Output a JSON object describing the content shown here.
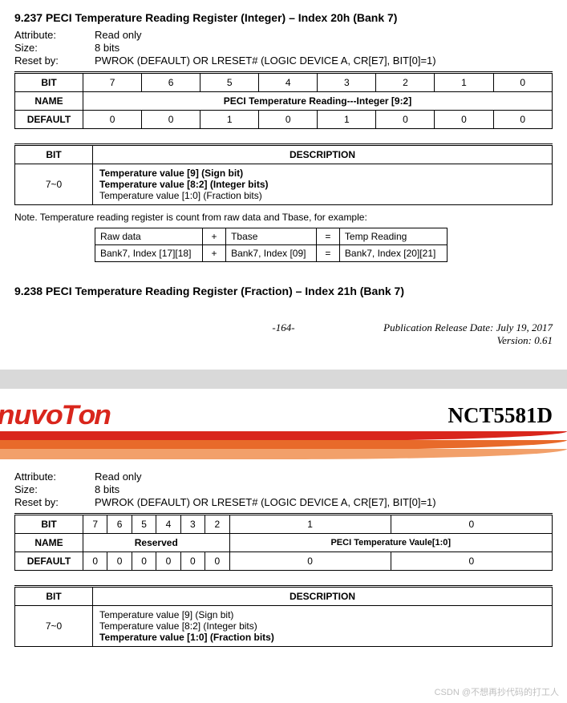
{
  "sec1": {
    "title": "9.237  PECI Temperature Reading Register (Integer) – Index 20h (Bank 7)",
    "attribute_l": "Attribute:",
    "attribute_v": "Read only",
    "size_l": "Size:",
    "size_v": "8 bits",
    "reset_l": "Reset by:",
    "reset_v": "PWROK (DEFAULT) OR LRESET# (LOGIC DEVICE A, CR[E7], BIT[0]=1)",
    "bit_hdr": "BIT",
    "bits": [
      "7",
      "6",
      "5",
      "4",
      "3",
      "2",
      "1",
      "0"
    ],
    "name_hdr": "NAME",
    "name_span": "PECI Temperature Reading---Integer  [9:2]",
    "default_hdr": "DEFAULT",
    "defaults": [
      "0",
      "0",
      "1",
      "0",
      "1",
      "0",
      "0",
      "0"
    ],
    "desc": {
      "hdr_bit": "BIT",
      "hdr_desc": "DESCRIPTION",
      "bit": "7~0",
      "l1": "Temperature value [9] (Sign bit)",
      "l2": "Temperature value [8:2] (Integer bits)",
      "l3": "Temperature value [1:0] (Fraction bits)"
    },
    "note": "Note. Temperature reading register is count from raw data and Tbase, for example:",
    "ex": {
      "r1c1": "Raw data",
      "plus": "+",
      "r1c2": "Tbase",
      "eq": "=",
      "r1c3": "Temp Reading",
      "r2c1": "Bank7, Index [17][18]",
      "r2c2": "Bank7, Index [09]",
      "r2c3": "Bank7, Index [20][21]"
    }
  },
  "sec2": {
    "title": "9.238  PECI Temperature Reading Register (Fraction) – Index 21h (Bank 7)"
  },
  "footer": {
    "page": "-164-",
    "l1": "Publication Release Date: July 19, 2017",
    "l2": "Version: 0.61"
  },
  "brand": {
    "logo": "nUVOTON",
    "part": "NCT5581D"
  },
  "sec3": {
    "attribute_l": "Attribute:",
    "attribute_v": "Read only",
    "size_l": "Size:",
    "size_v": "8 bits",
    "reset_l": "Reset by:",
    "reset_v": "PWROK (DEFAULT) OR LRESET# (LOGIC DEVICE A, CR[E7], BIT[0]=1)",
    "bit_hdr": "BIT",
    "bits": [
      "7",
      "6",
      "5",
      "4",
      "3",
      "2",
      "1",
      "0"
    ],
    "name_hdr": "NAME",
    "name_reserved": "Reserved",
    "name_peci": "PECI Temperature Vaule[1:0]",
    "default_hdr": "DEFAULT",
    "defaults": [
      "0",
      "0",
      "0",
      "0",
      "0",
      "0",
      "0",
      "0"
    ],
    "desc": {
      "hdr_bit": "BIT",
      "hdr_desc": "DESCRIPTION",
      "bit": "7~0",
      "l1": "Temperature value [9] (Sign bit)",
      "l2": "Temperature value [8:2] (Integer bits)",
      "l3": "Temperature value [1:0] (Fraction bits)"
    }
  },
  "watermark": "CSDN @不想再抄代码的打工人"
}
